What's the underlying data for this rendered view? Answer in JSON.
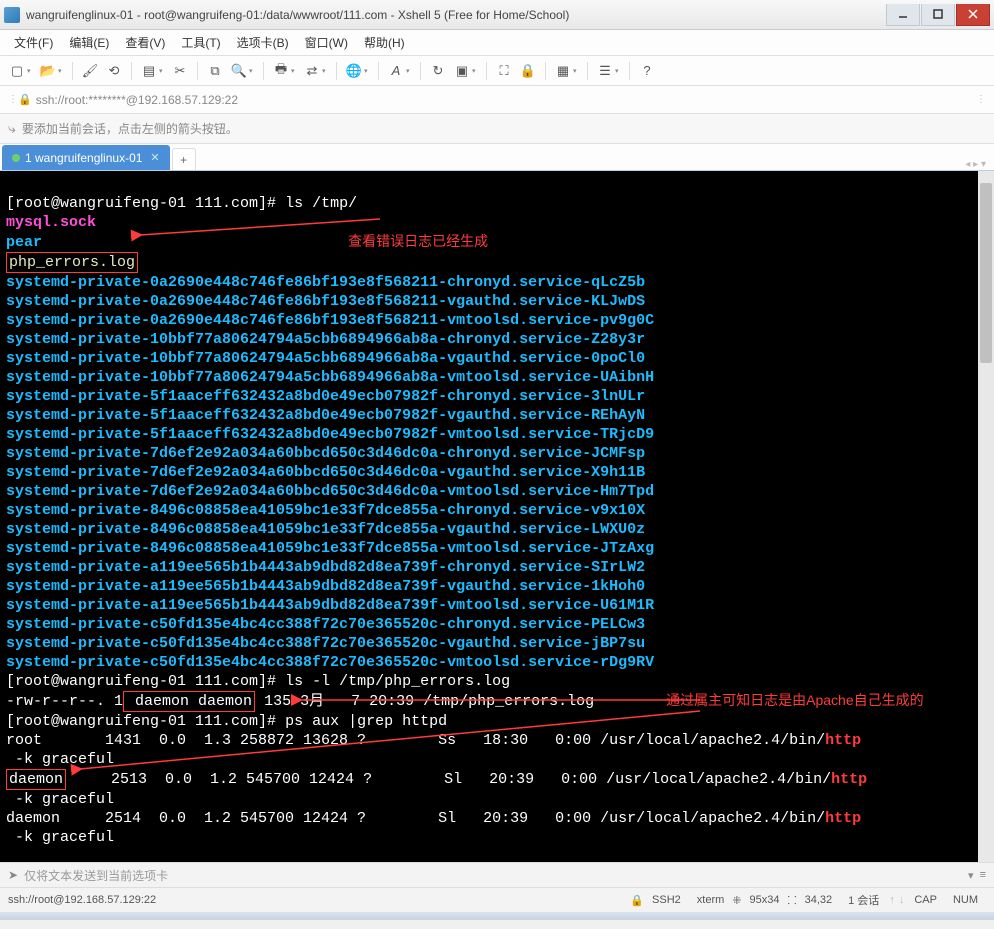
{
  "window": {
    "title": "wangruifenglinux-01 - root@wangruifeng-01:/data/wwwroot/111.com - Xshell 5 (Free for Home/School)"
  },
  "menu": {
    "file": "文件(F)",
    "edit": "编辑(E)",
    "view": "查看(V)",
    "tools": "工具(T)",
    "tabs": "选项卡(B)",
    "window": "窗口(W)",
    "help": "帮助(H)"
  },
  "address": {
    "text": "ssh://root:********@192.168.57.129:22"
  },
  "hint": {
    "text": "要添加当前会话，点击左侧的箭头按钮。"
  },
  "tabs": {
    "active": "1 wangruifenglinux-01"
  },
  "terminal": {
    "prompt1": "[root@wangruifeng-01 111.com]#",
    "cmd_ls_tmp": "ls /tmp/",
    "mysql_sock": "mysql.sock",
    "pear": "pear",
    "php_errors": "php_errors.log",
    "anno_error_log": "查看错误日志已经生成",
    "systemd_lines": [
      "systemd-private-0a2690e448c746fe86bf193e8f568211-chronyd.service-qLcZ5b",
      "systemd-private-0a2690e448c746fe86bf193e8f568211-vgauthd.service-KLJwDS",
      "systemd-private-0a2690e448c746fe86bf193e8f568211-vmtoolsd.service-pv9g0C",
      "systemd-private-10bbf77a80624794a5cbb6894966ab8a-chronyd.service-Z28y3r",
      "systemd-private-10bbf77a80624794a5cbb6894966ab8a-vgauthd.service-0poCl0",
      "systemd-private-10bbf77a80624794a5cbb6894966ab8a-vmtoolsd.service-UAibnH",
      "systemd-private-5f1aaceff632432a8bd0e49ecb07982f-chronyd.service-3lnULr",
      "systemd-private-5f1aaceff632432a8bd0e49ecb07982f-vgauthd.service-REhAyN",
      "systemd-private-5f1aaceff632432a8bd0e49ecb07982f-vmtoolsd.service-TRjcD9",
      "systemd-private-7d6ef2e92a034a60bbcd650c3d46dc0a-chronyd.service-JCMFsp",
      "systemd-private-7d6ef2e92a034a60bbcd650c3d46dc0a-vgauthd.service-X9h11B",
      "systemd-private-7d6ef2e92a034a60bbcd650c3d46dc0a-vmtoolsd.service-Hm7Tpd",
      "systemd-private-8496c08858ea41059bc1e33f7dce855a-chronyd.service-v9x10X",
      "systemd-private-8496c08858ea41059bc1e33f7dce855a-vgauthd.service-LWXU0z",
      "systemd-private-8496c08858ea41059bc1e33f7dce855a-vmtoolsd.service-JTzAxg",
      "systemd-private-a119ee565b1b4443ab9dbd82d8ea739f-chronyd.service-SIrLW2",
      "systemd-private-a119ee565b1b4443ab9dbd82d8ea739f-vgauthd.service-1kHoh0",
      "systemd-private-a119ee565b1b4443ab9dbd82d8ea739f-vmtoolsd.service-U61M1R",
      "systemd-private-c50fd135e4bc4cc388f72c70e365520c-chronyd.service-PELCw3",
      "systemd-private-c50fd135e4bc4cc388f72c70e365520c-vgauthd.service-jBP7su",
      "systemd-private-c50fd135e4bc4cc388f72c70e365520c-vmtoolsd.service-rDg9RV"
    ],
    "cmd_ls_l": "ls -l /tmp/php_errors.log",
    "ls_l_perm": "-rw-r--r--. 1",
    "ls_l_owner": " daemon daemon",
    "ls_l_rest": " 135 3月   7 20:39 /tmp/php_errors.log",
    "anno_owner": "通过属主可知日志是由Apache自己生成的",
    "cmd_ps": "ps aux |grep httpd",
    "ps1_a": "root       1431  0.0  1.3 258872 13628 ?        Ss   18:30   0:00 /usr/local/apache2.4/bin/",
    "ps_httpd": "http",
    "ps_cont": " -k graceful",
    "ps2_user": "daemon",
    "ps2_rest": "     2513  0.0  1.2 545700 12424 ?        Sl   20:39   0:00 /usr/local/apache2.4/bin/",
    "ps3": "daemon     2514  0.0  1.2 545700 12424 ?        Sl   20:39   0:00 /usr/local/apache2.4/bin/"
  },
  "sendbar": {
    "placeholder": "仅将文本发送到当前选项卡"
  },
  "status": {
    "conn": "ssh://root@192.168.57.129:22",
    "proto": "SSH2",
    "term": "xterm",
    "size": "95x34",
    "pos": "34,32",
    "sessions": "1 会话",
    "cap": "CAP",
    "num": "NUM"
  }
}
